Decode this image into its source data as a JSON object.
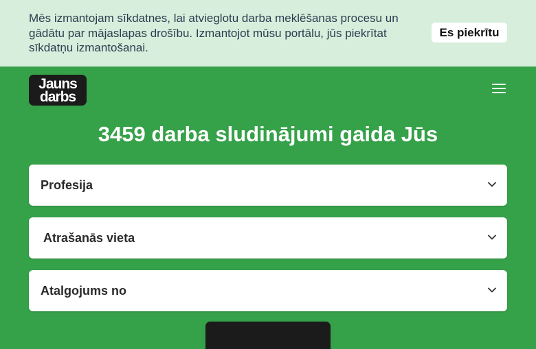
{
  "cookie_notice": {
    "text": "Mēs izmantojam sīkdatnes, lai atvieglotu darba meklēšanas procesu un gādātu par mājaslapas drošību. Izmantojot mūsu portālu, jūs piekrītat sīkdatņu izmantošanai.",
    "accept_label": "Es piekrītu",
    "background_color": "#d6eedb"
  },
  "header": {
    "logo_line1": "Jauns",
    "logo_line2": "darbs",
    "menu_icon": "hamburger-menu-icon"
  },
  "hero": {
    "title": "3459 darba sludinājumi gaida Jūs"
  },
  "filters": [
    {
      "label": "Profesija",
      "icon": "chevron-down-icon"
    },
    {
      "label": "Atrašanās vieta",
      "icon": "chevron-down-icon"
    },
    {
      "label": "Atalgojums no",
      "icon": "chevron-down-icon"
    }
  ],
  "colors": {
    "brand_green": "#35a149",
    "dark": "#1b1b1b"
  }
}
